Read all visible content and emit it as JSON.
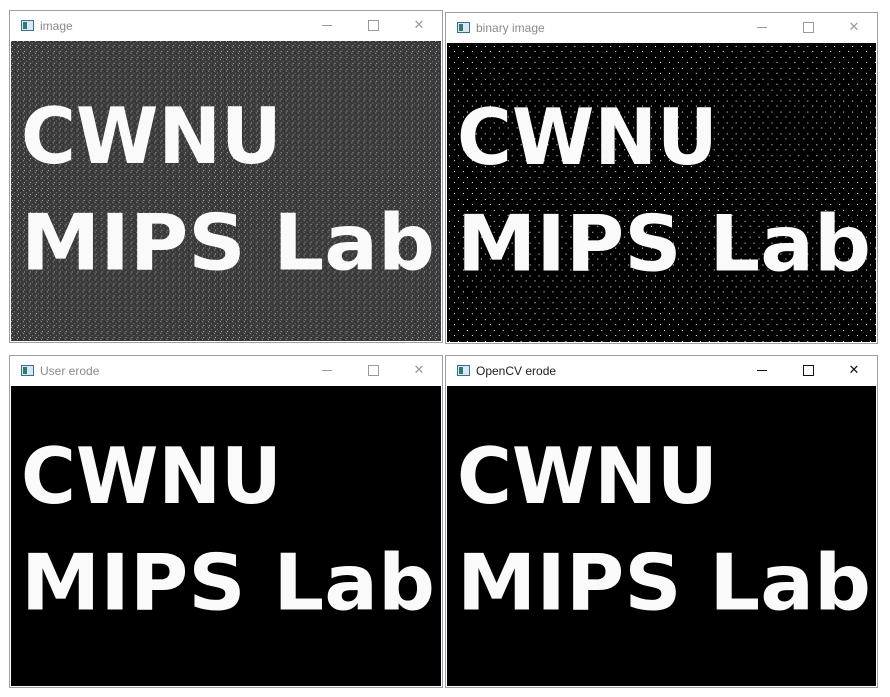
{
  "windows": [
    {
      "id": "image",
      "title": "image",
      "active": false,
      "line1": "CWNU",
      "line2": "MIPS Lab",
      "style": "noisy"
    },
    {
      "id": "binary",
      "title": "binary image",
      "active": false,
      "line1": "CWNU",
      "line2": "MIPS Lab",
      "style": "binary"
    },
    {
      "id": "user",
      "title": "User erode",
      "active": false,
      "line1": "CWNU",
      "line2": "MIPS Lab",
      "style": "eroded"
    },
    {
      "id": "opencv",
      "title": "OpenCV erode",
      "active": true,
      "line1": "CWNU",
      "line2": "MIPS Lab",
      "style": "eroded"
    }
  ],
  "controls": {
    "minimize": "minimize",
    "maximize": "maximize",
    "close": "✕"
  }
}
